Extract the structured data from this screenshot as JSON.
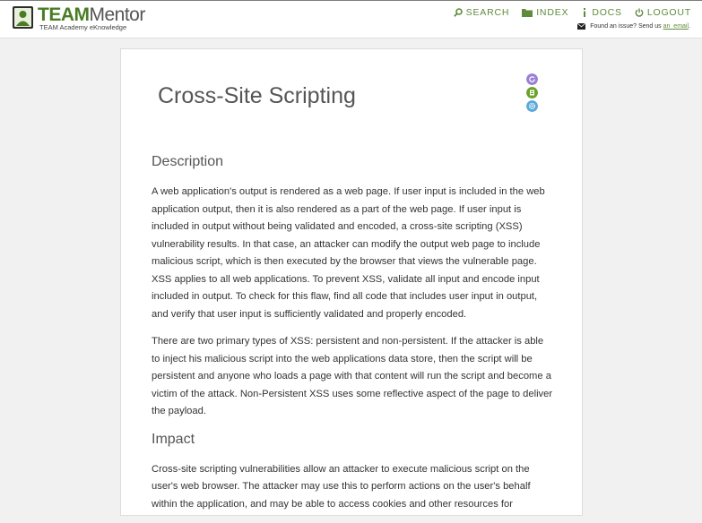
{
  "brand": {
    "title_accent": "TEAM",
    "title_rest": "Mentor",
    "subtitle": "TEAM Academy eKnowledge"
  },
  "nav": {
    "search": "SEARCH",
    "index": "INDEX",
    "docs": "DOCS",
    "logout": "LOGOUT"
  },
  "issue": {
    "text": "Found an issue? Send us",
    "link": "an_email",
    "suffix": "."
  },
  "article": {
    "title": "Cross-Site Scripting",
    "sections": [
      {
        "heading": "Description",
        "paragraphs": [
          "A web application's output is rendered as a web page. If user input is included in the web application output, then it is also rendered as a part of the web page. If user input is included in output without being validated and encoded, a cross-site scripting (XSS) vulnerability results. In that case, an attacker can modify the output web page to include malicious script, which is then executed by the browser that views the vulnerable page. XSS applies to all web applications. To prevent XSS, validate all input and encode input included in output. To check for this flaw, find all code that includes user input in output, and verify that user input is sufficiently validated and properly encoded.",
          "There are two primary types of XSS: persistent and non-persistent. If the attacker is able to inject his malicious script into the web applications data store, then the script will be persistent and anyone who loads a page with that content will run the script and become a victim of the attack. Non-Persistent XSS uses some reflective aspect of the page to deliver the payload."
        ]
      },
      {
        "heading": "Impact",
        "paragraphs": [
          "Cross-site scripting vulnerabilities allow an attacker to execute malicious script on the user's web browser. The attacker may use this to perform actions on the user's behalf within the application, and may be able to access cookies and other resources for"
        ]
      }
    ]
  },
  "colors": {
    "accent": "#5f8b3a",
    "icon_purple": "#9b7fd4",
    "icon_green": "#6aa22c",
    "icon_blue": "#5aa9d8"
  },
  "icons": {
    "search": "search-icon",
    "index": "folder-icon",
    "docs": "info-icon",
    "logout": "power-icon",
    "mail": "mail-icon",
    "side": [
      "refresh-icon",
      "bookmark-icon",
      "settings-icon"
    ]
  }
}
